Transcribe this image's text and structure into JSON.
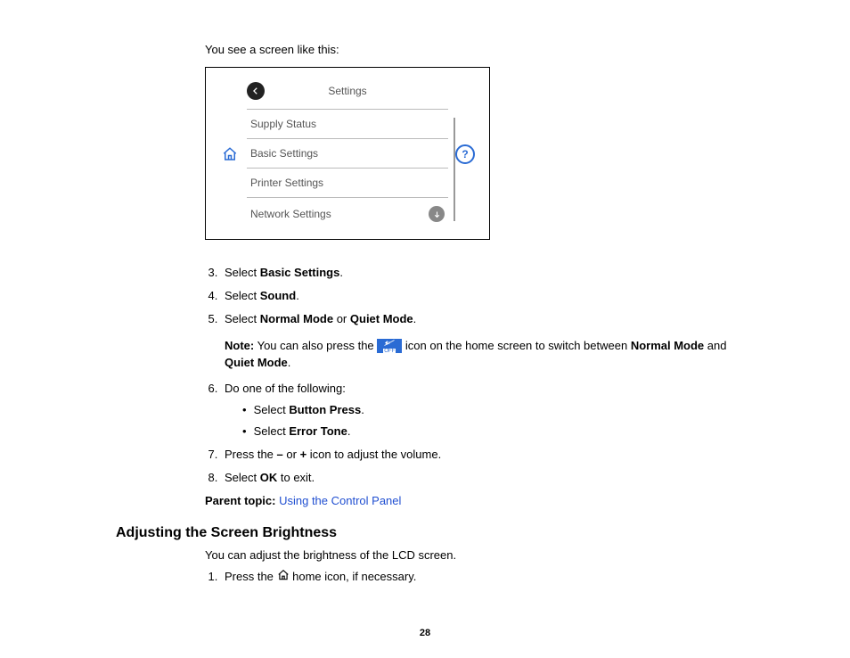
{
  "intro": "You see a screen like this:",
  "screenshot": {
    "title": "Settings",
    "rows": [
      "Supply Status",
      "Basic Settings",
      "Printer Settings",
      "Network Settings"
    ]
  },
  "steps_a": {
    "s3_pre": "Select ",
    "s3_bold": "Basic Settings",
    "s3_post": ".",
    "s4_pre": "Select ",
    "s4_bold": "Sound",
    "s4_post": ".",
    "s5_pre": "Select ",
    "s5_b1": "Normal Mode",
    "s5_mid": " or ",
    "s5_b2": "Quiet Mode",
    "s5_post": "."
  },
  "note": {
    "label": "Note:",
    "t1": " You can also press the ",
    "t2": " icon on the home screen to switch between ",
    "b1": "Normal Mode",
    "t3": " and ",
    "b2": "Quiet Mode",
    "t4": "."
  },
  "step6_intro": "Do one of the following:",
  "step6_sub": {
    "a_pre": "Select ",
    "a_bold": "Button Press",
    "a_post": ".",
    "b_pre": "Select ",
    "b_bold": "Error Tone",
    "b_post": "."
  },
  "step7": {
    "pre": "Press the ",
    "b1": "–",
    "mid": " or ",
    "b2": "+",
    "post": " icon to adjust the volume."
  },
  "step8": {
    "pre": "Select ",
    "b1": "OK",
    "post": " to exit."
  },
  "parent": {
    "label": "Parent topic:",
    "link": "Using the Control Panel"
  },
  "heading2": "Adjusting the Screen Brightness",
  "h2_intro": "You can adjust the brightness of the LCD screen.",
  "h2_step1": {
    "pre": "Press the ",
    "post": " home icon, if necessary."
  },
  "pageNumber": "28"
}
